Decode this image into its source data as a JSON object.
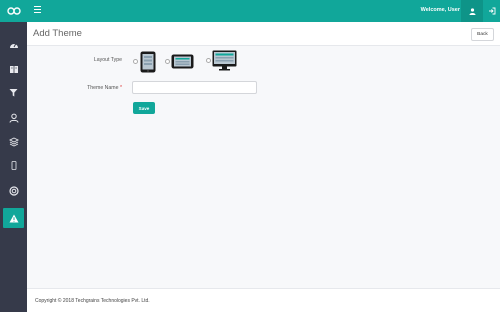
{
  "topbar": {
    "welcome_text": "Welcome, User",
    "user_icon": "user-icon",
    "logout_icon": "logout-icon",
    "menu_icon": "hamburger-icon"
  },
  "sidebar": {
    "logo_icon": "infinity-logo-icon",
    "items": [
      {
        "icon": "dashboard-icon",
        "active": false
      },
      {
        "icon": "book-icon",
        "active": false
      },
      {
        "icon": "filter-icon",
        "active": false
      },
      {
        "icon": "user-icon",
        "active": false
      },
      {
        "icon": "layers-icon",
        "active": false
      },
      {
        "icon": "mobile-icon",
        "active": false
      },
      {
        "icon": "lifebuoy-icon",
        "active": false
      },
      {
        "icon": "warning-icon",
        "active": true
      }
    ]
  },
  "header": {
    "title": "Add Theme",
    "back_label": "Back"
  },
  "form": {
    "layout_type_label": "Layout Type",
    "layout_options": [
      {
        "icon": "tablet-portrait-icon",
        "selected": false
      },
      {
        "icon": "tablet-landscape-icon",
        "selected": false
      },
      {
        "icon": "desktop-icon",
        "selected": false
      }
    ],
    "theme_name_label": "Theme Name",
    "required_mark": "*",
    "theme_name_value": "",
    "save_label": "Save"
  },
  "footer": {
    "copyright": "Copyright © 2018 Techgrains Technologies Pvt. Ltd."
  },
  "colors": {
    "primary": "#11a79a",
    "sidebar_bg": "#363a4a",
    "content_bg": "#f7f8fa"
  }
}
